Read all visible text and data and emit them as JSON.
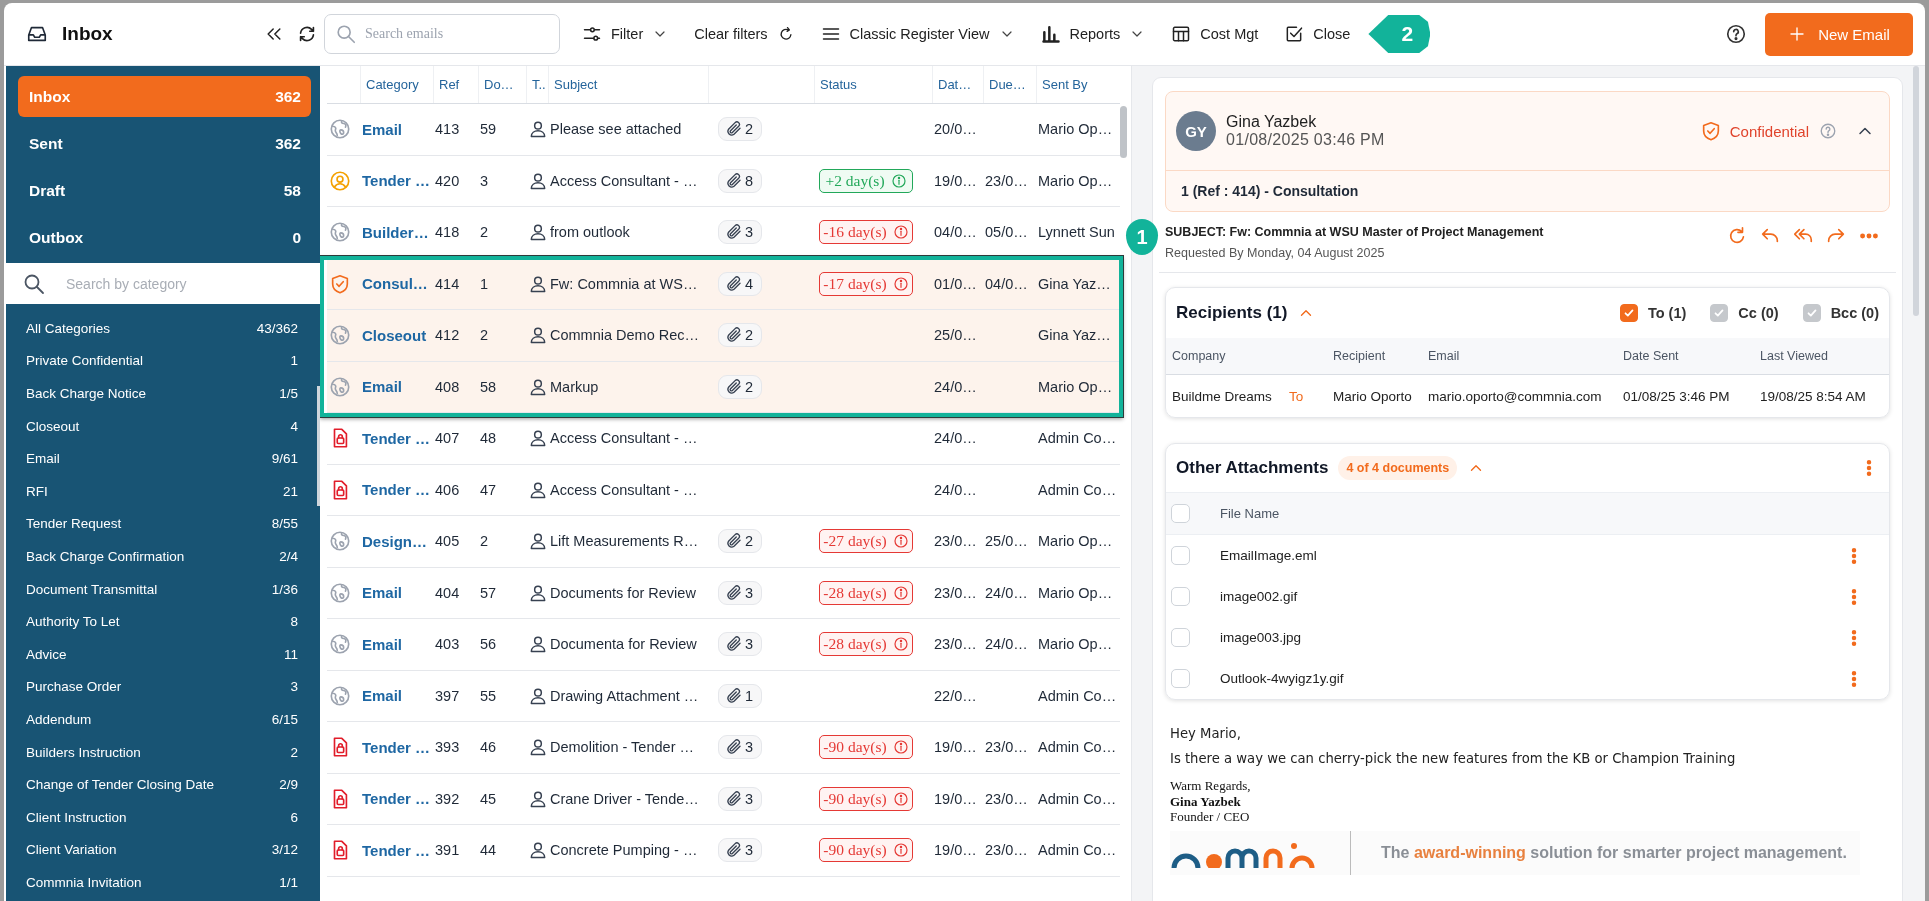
{
  "toolbar": {
    "title": "Inbox",
    "search": {
      "placeholder": "Search emails"
    },
    "actions": [
      {
        "kind": "filter",
        "label": "Filter",
        "dropdown": true
      },
      {
        "kind": "clear",
        "label": "Clear filters",
        "dropdown": false
      },
      {
        "kind": "view",
        "label": "Classic Register View",
        "dropdown": true
      },
      {
        "kind": "reports",
        "label": "Reports",
        "dropdown": true
      },
      {
        "kind": "cost",
        "label": "Cost Mgt",
        "dropdown": false
      },
      {
        "kind": "close",
        "label": "Close",
        "dropdown": false
      }
    ],
    "new_button": "New Email"
  },
  "folders": [
    {
      "label": "Inbox",
      "count": "362",
      "selected": true
    },
    {
      "label": "Sent",
      "count": "362",
      "selected": false
    },
    {
      "label": "Draft",
      "count": "58",
      "selected": false
    },
    {
      "label": "Outbox",
      "count": "0",
      "selected": false
    }
  ],
  "category_search": {
    "placeholder": "Search by category"
  },
  "categories": [
    {
      "label": "All Categories",
      "count": "43/362"
    },
    {
      "label": "Private Confidential",
      "count": "1"
    },
    {
      "label": "Back Charge Notice",
      "count": "1/5"
    },
    {
      "label": "Closeout",
      "count": "4"
    },
    {
      "label": "Email",
      "count": "9/61"
    },
    {
      "label": "RFI",
      "count": "21"
    },
    {
      "label": "Tender Request",
      "count": "8/55"
    },
    {
      "label": "Back Charge Confirmation",
      "count": "2/4"
    },
    {
      "label": "Document Transmittal",
      "count": "1/36"
    },
    {
      "label": "Authority To Let",
      "count": "8"
    },
    {
      "label": "Advice",
      "count": "11"
    },
    {
      "label": "Purchase Order",
      "count": "3"
    },
    {
      "label": "Addendum",
      "count": "6/15"
    },
    {
      "label": "Builders Instruction",
      "count": "2"
    },
    {
      "label": "Change of Tender Closing Date",
      "count": "2/9"
    },
    {
      "label": "Client Instruction",
      "count": "6"
    },
    {
      "label": "Client Variation",
      "count": "3/12"
    },
    {
      "label": "Commnia Invitation",
      "count": "1/1"
    }
  ],
  "table": {
    "columns": [
      "Category",
      "Ref",
      "Do…",
      "T..",
      "Subject",
      "Status",
      "Dat…",
      "Due…",
      "Sent By"
    ],
    "rows": [
      {
        "kind": "globe",
        "category": "Email",
        "ref": "413",
        "doc": "59",
        "subject": "Please see attached",
        "attachments": "2",
        "date": "20/0…",
        "sent_by": "Mario Op…",
        "selected": false
      },
      {
        "kind": "user",
        "category": "Tender …",
        "ref": "420",
        "doc": "3",
        "subject": "Access Consultant - …",
        "attachments": "8",
        "status": {
          "text": "+2 day(s)",
          "kind": "ahead"
        },
        "date": "19/0…",
        "due": "23/0…",
        "sent_by": "Mario Op…",
        "selected": false
      },
      {
        "kind": "globe",
        "category": "Builder…",
        "ref": "418",
        "doc": "2",
        "subject": "from outlook",
        "attachments": "3",
        "status": {
          "text": "-16 day(s)",
          "kind": "overdue"
        },
        "date": "04/0…",
        "due": "05/0…",
        "sent_by": "Lynnett Sun",
        "selected": false
      },
      {
        "kind": "shield",
        "category": "Consul…",
        "ref": "414",
        "doc": "1",
        "subject": "Fw: Commnia at WS…",
        "attachments": "4",
        "status": {
          "text": "-17 day(s)",
          "kind": "overdue"
        },
        "date": "01/0…",
        "due": "04/0…",
        "sent_by": "Gina Yaz…",
        "selected": true
      },
      {
        "kind": "globe",
        "category": "Closeout",
        "ref": "412",
        "doc": "2",
        "subject": "Commnia Demo Rec…",
        "attachments": "2",
        "date": "25/0…",
        "sent_by": "Gina Yaz…",
        "selected": true
      },
      {
        "kind": "globe",
        "category": "Email",
        "ref": "408",
        "doc": "58",
        "subject": "Markup",
        "attachments": "2",
        "date": "24/0…",
        "sent_by": "Mario Op…",
        "selected": true
      },
      {
        "kind": "document",
        "category": "Tender …",
        "ref": "407",
        "doc": "48",
        "subject": "Access Consultant - …",
        "date": "24/0…",
        "sent_by": "Admin Co…",
        "selected": false
      },
      {
        "kind": "document",
        "category": "Tender …",
        "ref": "406",
        "doc": "47",
        "subject": "Access Consultant - …",
        "date": "24/0…",
        "sent_by": "Admin Co…",
        "selected": false
      },
      {
        "kind": "globe",
        "category": "Design…",
        "ref": "405",
        "doc": "2",
        "subject": "Lift Measurements R…",
        "attachments": "2",
        "status": {
          "text": "-27 day(s)",
          "kind": "overdue"
        },
        "date": "23/0…",
        "due": "25/0…",
        "sent_by": "Mario Op…",
        "selected": false
      },
      {
        "kind": "globe",
        "category": "Email",
        "ref": "404",
        "doc": "57",
        "subject": "Documents for Review",
        "attachments": "3",
        "status": {
          "text": "-28 day(s)",
          "kind": "overdue"
        },
        "date": "23/0…",
        "due": "24/0…",
        "sent_by": "Mario Op…",
        "selected": false
      },
      {
        "kind": "globe",
        "category": "Email",
        "ref": "403",
        "doc": "56",
        "subject": "Documenta for Review",
        "attachments": "3",
        "status": {
          "text": "-28 day(s)",
          "kind": "overdue"
        },
        "date": "23/0…",
        "due": "24/0…",
        "sent_by": "Mario Op…",
        "selected": false
      },
      {
        "kind": "globe",
        "category": "Email",
        "ref": "397",
        "doc": "55",
        "subject": "Drawing Attachment …",
        "attachments": "1",
        "date": "22/0…",
        "sent_by": "Admin Co…",
        "selected": false
      },
      {
        "kind": "document",
        "category": "Tender …",
        "ref": "393",
        "doc": "46",
        "subject": "Demolition - Tender …",
        "attachments": "3",
        "status": {
          "text": "-90 day(s)",
          "kind": "overdue"
        },
        "date": "19/0…",
        "due": "23/0…",
        "sent_by": "Admin Co…",
        "selected": false
      },
      {
        "kind": "document",
        "category": "Tender …",
        "ref": "392",
        "doc": "45",
        "subject": "Crane Driver - Tende…",
        "attachments": "3",
        "status": {
          "text": "-90 day(s)",
          "kind": "overdue"
        },
        "date": "19/0…",
        "due": "23/0…",
        "sent_by": "Admin Co…",
        "selected": false
      },
      {
        "kind": "document",
        "category": "Tender …",
        "ref": "391",
        "doc": "44",
        "subject": "Concrete Pumping - …",
        "attachments": "3",
        "status": {
          "text": "-90 day(s)",
          "kind": "overdue"
        },
        "date": "19/0…",
        "due": "23/0…",
        "sent_by": "Admin Co…",
        "selected": false
      }
    ]
  },
  "message": {
    "initials": "GY",
    "sender": "Gina Yazbek",
    "date": "01/08/2025 03:46 PM",
    "sensitivity": "Confidential",
    "expanded": true,
    "reference": "1 (Ref : 414) - Consultation",
    "subject": "SUBJECT: Fw: Commnia at WSU Master of Project Management",
    "requested": "Requested By Monday, 04 August 2025"
  },
  "recipients": {
    "title": "Recipients (1)",
    "expanded": true,
    "filters": [
      {
        "label": "To (1)",
        "checked": true,
        "disabled": false
      },
      {
        "label": "Cc (0)",
        "checked": true,
        "disabled": true
      },
      {
        "label": "Bcc (0)",
        "checked": true,
        "disabled": true
      }
    ],
    "columns": [
      "Company",
      "Recipient",
      "Email",
      "Date Sent",
      "Last Viewed"
    ],
    "rows": [
      {
        "company": "Buildme Dreams",
        "type": "To",
        "recipient": "Mario Oporto",
        "email": "mario.oporto@commnia.com",
        "date_sent": "01/08/25 3:46 PM",
        "last_viewed": "19/08/25 8:54 AM"
      }
    ]
  },
  "attachments": {
    "title": "Other Attachments",
    "badge": "4 of 4 documents",
    "expanded": true,
    "column": "File Name",
    "select_all": {
      "checked": false
    },
    "files": [
      {
        "name": "EmailImage.eml",
        "checked": false
      },
      {
        "name": "image002.gif",
        "checked": false
      },
      {
        "name": "image003.jpg",
        "checked": false
      },
      {
        "name": "Outlook-4wyigz1y.gif",
        "checked": false
      }
    ]
  },
  "body": {
    "greeting": "Hey Mario,",
    "paragraph": "Is there a way we can cherry-pick the new features from the KB or Champion Training",
    "signature": {
      "closing": "Warm Regards,",
      "name": "Gina Yazbek",
      "title": "Founder / CEO"
    },
    "banner": {
      "tagline": [
        {
          "text": "The ",
          "accent": false
        },
        {
          "text": "award-winning",
          "accent": true
        },
        {
          "text": " solution for smarter project management.",
          "accent": false
        }
      ]
    }
  },
  "callouts": [
    {
      "label": "1"
    },
    {
      "label": "2"
    }
  ]
}
